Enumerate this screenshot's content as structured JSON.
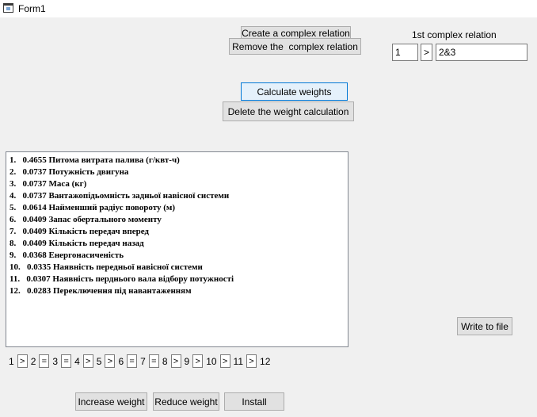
{
  "window": {
    "title": "Form1"
  },
  "buttons": {
    "create_relation": "Create a complex relation",
    "remove_relation": "Remove the  complex relation",
    "calculate_weights": "Calculate weights",
    "delete_weight_calc": "Delete the weight calculation",
    "write_to_file": "Write to file",
    "increase_weight": "Increase weight",
    "reduce_weight": "Reduce weight",
    "install": "Install"
  },
  "relation": {
    "label": "1st complex relation",
    "left_value": "1",
    "operator": ">",
    "right_value": "2&3"
  },
  "results": [
    "1.   0.4655 Питома витрата палива (г/квт-ч)",
    "2.   0.0737 Потужність двигуна",
    "3.   0.0737 Маса (кг)",
    "4.   0.0737 Вантажопідьомність задньої навісної системи",
    "5.   0.0614 Найменший радіус повороту (м)",
    "6.   0.0409 Запас обертального моменту",
    "7.   0.0409 Кількість передач вперед",
    "8.   0.0409 Кількість передач назад",
    "9.   0.0368 Енергонасиченість",
    "10.   0.0335 Наявність передньої навісної системи",
    "11.   0.0307 Наявність перднього вала відбору потужності",
    "12.   0.0283 Переключення під навантаженням"
  ],
  "sequence": {
    "numbers": [
      "1",
      "2",
      "3",
      "4",
      "5",
      "6",
      "7",
      "8",
      "9",
      "10",
      "11",
      "12"
    ],
    "operators": [
      ">",
      "=",
      "=",
      ">",
      ">",
      "=",
      "=",
      ">",
      ">",
      ">",
      ">"
    ]
  }
}
